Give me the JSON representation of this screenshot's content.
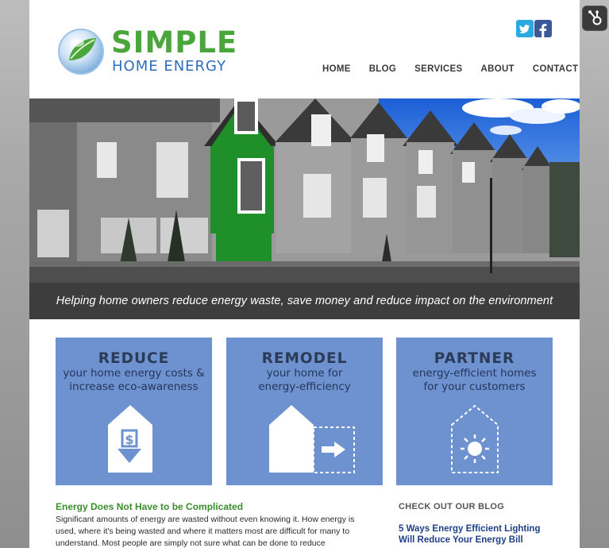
{
  "brand": {
    "name_line1": "SIMPLE",
    "name_line2": "HOME ENERGY",
    "primary_green": "#4aa63b",
    "primary_blue": "#2f6dbf"
  },
  "social": [
    {
      "name": "twitter",
      "icon": "twitter-icon"
    },
    {
      "name": "facebook",
      "icon": "facebook-icon"
    }
  ],
  "nav": {
    "items": [
      "HOME",
      "BLOG",
      "SERVICES",
      "ABOUT",
      "CONTACT"
    ]
  },
  "hero": {
    "tagline": "Helping home owners reduce energy waste, save money and reduce impact on the environment"
  },
  "cards": [
    {
      "title": "REDUCE",
      "line1": "your home energy costs &",
      "line2": "increase eco-awareness",
      "icon": "house-dollar-down-icon"
    },
    {
      "title": "REMODEL",
      "line1": "your home for",
      "line2": "energy-efficiency",
      "icon": "house-expand-arrow-icon"
    },
    {
      "title": "PARTNER",
      "line1": "energy-efficient homes",
      "line2": "for your customers",
      "icon": "house-sun-icon"
    }
  ],
  "intro": {
    "title": "Energy Does Not Have to be Complicated",
    "body": "Significant amounts of energy are wasted without even knowing it. How energy is used, where it's being wasted and where it matters most are difficult for many to understand. Most people are simply not sure what can be done to reduce"
  },
  "blog": {
    "heading": "CHECK OUT OUR BLOG",
    "post_title_line1": "5 Ways Energy Efficient Lighting",
    "post_title_line2": "Will Reduce Your Energy Bill"
  },
  "hubspot": {
    "icon": "hubspot-sprocket-icon"
  },
  "colors": {
    "card_blue": "#6e91cf",
    "tagline_bar": "#3d3d3d",
    "accent_green": "#3c8d2e",
    "link_blue": "#1f3f86"
  }
}
